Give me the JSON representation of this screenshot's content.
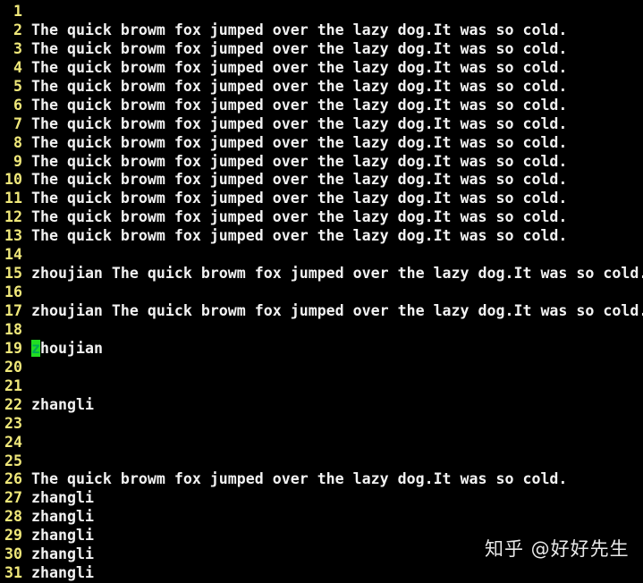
{
  "editor": {
    "cursor_line": 19,
    "lines": [
      {
        "n": "1",
        "text": ""
      },
      {
        "n": "2",
        "text": "The quick browm fox jumped over the lazy dog.It was so cold."
      },
      {
        "n": "3",
        "text": "The quick browm fox jumped over the lazy dog.It was so cold."
      },
      {
        "n": "4",
        "text": "The quick browm fox jumped over the lazy dog.It was so cold."
      },
      {
        "n": "5",
        "text": "The quick browm fox jumped over the lazy dog.It was so cold."
      },
      {
        "n": "6",
        "text": "The quick browm fox jumped over the lazy dog.It was so cold."
      },
      {
        "n": "7",
        "text": "The quick browm fox jumped over the lazy dog.It was so cold."
      },
      {
        "n": "8",
        "text": "The quick browm fox jumped over the lazy dog.It was so cold."
      },
      {
        "n": "9",
        "text": "The quick browm fox jumped over the lazy dog.It was so cold."
      },
      {
        "n": "10",
        "text": "The quick browm fox jumped over the lazy dog.It was so cold."
      },
      {
        "n": "11",
        "text": "The quick browm fox jumped over the lazy dog.It was so cold."
      },
      {
        "n": "12",
        "text": "The quick browm fox jumped over the lazy dog.It was so cold."
      },
      {
        "n": "13",
        "text": "The quick browm fox jumped over the lazy dog.It was so cold."
      },
      {
        "n": "14",
        "text": ""
      },
      {
        "n": "15",
        "text": "zhoujian The quick browm fox jumped over the lazy dog.It was so cold."
      },
      {
        "n": "16",
        "text": ""
      },
      {
        "n": "17",
        "text": "zhoujian The quick browm fox jumped over the lazy dog.It was so cold."
      },
      {
        "n": "18",
        "text": ""
      },
      {
        "n": "19",
        "cursor_char": "z",
        "text": "houjian"
      },
      {
        "n": "20",
        "text": ""
      },
      {
        "n": "21",
        "text": ""
      },
      {
        "n": "22",
        "text": "zhangli"
      },
      {
        "n": "23",
        "text": ""
      },
      {
        "n": "24",
        "text": ""
      },
      {
        "n": "25",
        "text": ""
      },
      {
        "n": "26",
        "text": "The quick browm fox jumped over the lazy dog.It was so cold."
      },
      {
        "n": "27",
        "text": "zhangli"
      },
      {
        "n": "28",
        "text": "zhangli"
      },
      {
        "n": "29",
        "text": "zhangli"
      },
      {
        "n": "30",
        "text": "zhangli"
      },
      {
        "n": "31",
        "text": "zhangli"
      }
    ]
  },
  "watermark": "知乎 @好好先生"
}
